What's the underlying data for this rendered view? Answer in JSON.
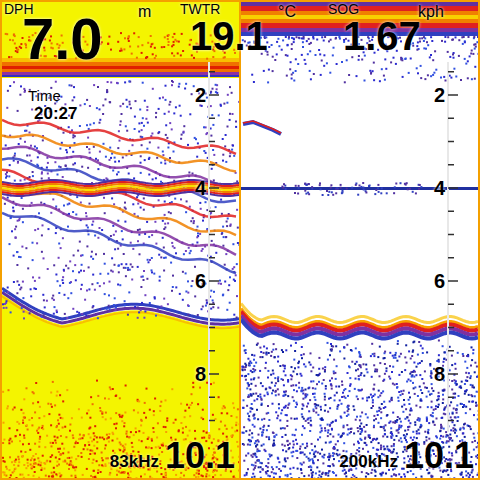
{
  "header": {
    "depth": {
      "label": "DPH",
      "value": "7.0",
      "unit": "m"
    },
    "water_temp": {
      "label": "TWTR",
      "value": "19.1",
      "unit": "°C"
    },
    "speed": {
      "label": "SOG",
      "value": "1.67",
      "unit": "kph"
    }
  },
  "time": {
    "label": "Time",
    "value": "20:27"
  },
  "panels": [
    {
      "kind": "low",
      "frequency": "83kHz",
      "range": "10.1",
      "scale": [
        "2",
        "4",
        "6",
        "8"
      ],
      "bottom_depth": 6.8,
      "layer_depth": 4.0
    },
    {
      "kind": "high",
      "frequency": "200kHz",
      "range": "10.1",
      "scale": [
        "2",
        "4",
        "6",
        "8"
      ],
      "bottom_depth": 7.0,
      "layer_depth": 4.0
    }
  ]
}
